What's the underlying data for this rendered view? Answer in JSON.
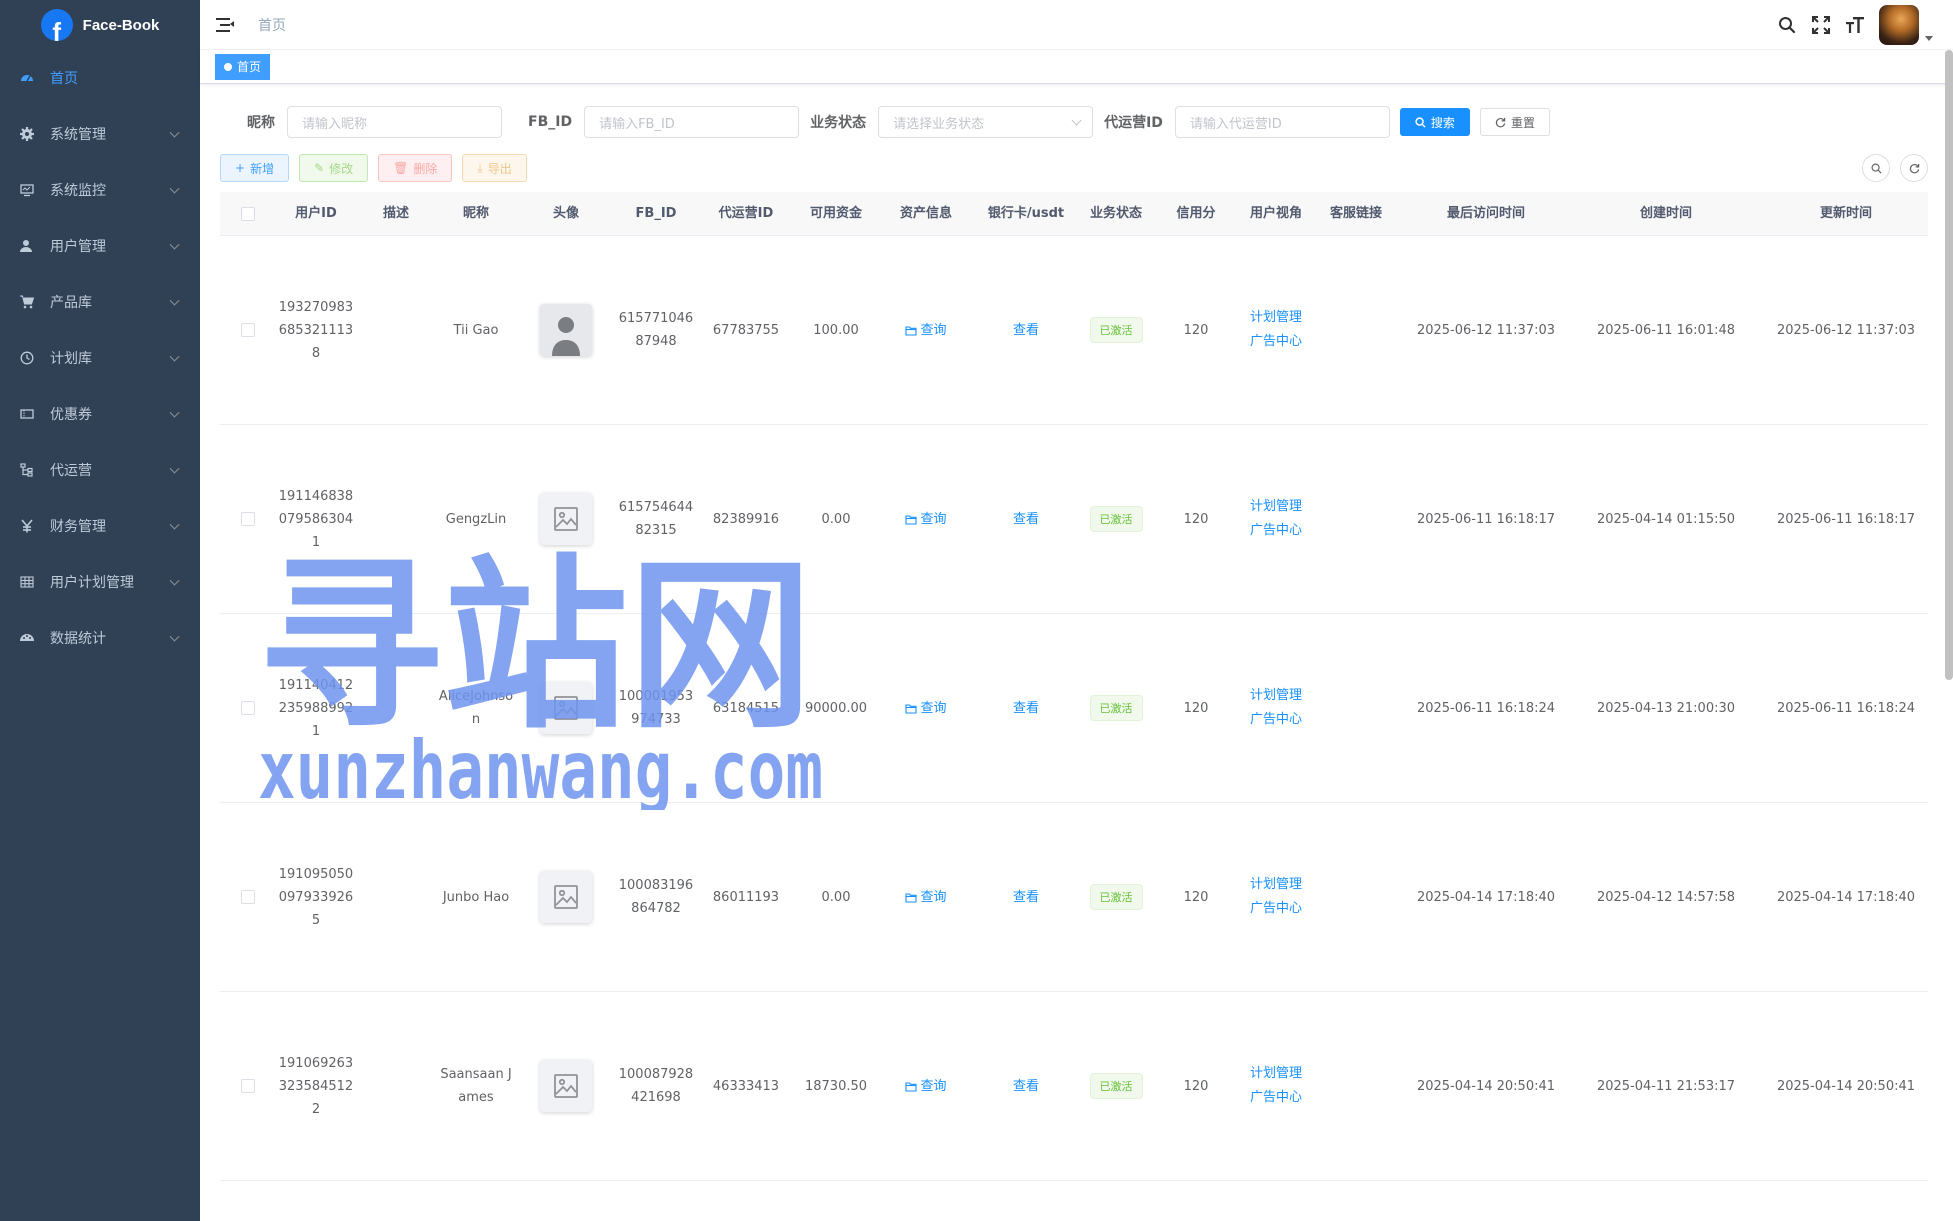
{
  "app": {
    "title": "Face-Book",
    "logo_letter": "f"
  },
  "sidebar": {
    "items": [
      {
        "label": "首页",
        "icon": "dashboard-icon",
        "active": true,
        "expandable": false
      },
      {
        "label": "系统管理",
        "icon": "gear-icon",
        "expandable": true
      },
      {
        "label": "系统监控",
        "icon": "monitor-icon",
        "expandable": true
      },
      {
        "label": "用户管理",
        "icon": "user-icon",
        "expandable": true
      },
      {
        "label": "产品库",
        "icon": "cart-icon",
        "expandable": true
      },
      {
        "label": "计划库",
        "icon": "clock-icon",
        "expandable": true
      },
      {
        "label": "优惠券",
        "icon": "coupon-icon",
        "expandable": true
      },
      {
        "label": "代运营",
        "icon": "tree-icon",
        "expandable": true
      },
      {
        "label": "财务管理",
        "icon": "yen-icon",
        "expandable": true
      },
      {
        "label": "用户计划管理",
        "icon": "table-icon",
        "expandable": true
      },
      {
        "label": "数据统计",
        "icon": "chart-icon",
        "expandable": true
      }
    ]
  },
  "navbar": {
    "breadcrumb": "首页"
  },
  "tags": {
    "active": "首页"
  },
  "search": {
    "nickname_label": "昵称",
    "nickname_placeholder": "请输入昵称",
    "fbid_label": "FB_ID",
    "fbid_placeholder": "请输入FB_ID",
    "status_label": "业务状态",
    "status_placeholder": "请选择业务状态",
    "agent_label": "代运营ID",
    "agent_placeholder": "请输入代运营ID",
    "search_btn": "搜索",
    "reset_btn": "重置"
  },
  "toolbar": {
    "add": "新增",
    "edit": "修改",
    "delete": "删除",
    "export": "导出"
  },
  "table": {
    "headers": [
      "用户ID",
      "描述",
      "昵称",
      "头像",
      "FB_ID",
      "代运营ID",
      "可用资金",
      "资产信息",
      "银行卡/usdt",
      "业务状态",
      "信用分",
      "用户视角",
      "客服链接",
      "最后访问时间",
      "创建时间",
      "更新时间"
    ],
    "rows": [
      {
        "id": "1932709836853211138",
        "desc": "",
        "nick": "Tii Gao",
        "avatar": "person",
        "fbid": "61577104687948",
        "agent": "67783755",
        "fund": "100.00",
        "asset": "查询",
        "bank": "查看",
        "status": "已激活",
        "credit": "120",
        "view1": "计划管理",
        "view2": "广告中心",
        "service": "",
        "last": "2025-06-12 11:37:03",
        "created": "2025-06-11 16:01:48",
        "updated": "2025-06-12 11:37:03"
      },
      {
        "id": "1911468380795863041",
        "desc": "",
        "nick": "GengzLin",
        "avatar": "image",
        "fbid": "61575464482315",
        "agent": "82389916",
        "fund": "0.00",
        "asset": "查询",
        "bank": "查看",
        "status": "已激活",
        "credit": "120",
        "view1": "计划管理",
        "view2": "广告中心",
        "service": "",
        "last": "2025-06-11 16:18:17",
        "created": "2025-04-14 01:15:50",
        "updated": "2025-06-11 16:18:17"
      },
      {
        "id": "1911404122359889921",
        "desc": "",
        "nick": "AliceJohnson",
        "avatar": "image",
        "fbid": "100001953974733",
        "agent": "63184515",
        "fund": "90000.00",
        "asset": "查询",
        "bank": "查看",
        "status": "已激活",
        "credit": "120",
        "view1": "计划管理",
        "view2": "广告中心",
        "service": "",
        "last": "2025-06-11 16:18:24",
        "created": "2025-04-13 21:00:30",
        "updated": "2025-06-11 16:18:24"
      },
      {
        "id": "1910950500979339265",
        "desc": "",
        "nick": "Junbo Hao",
        "avatar": "image",
        "fbid": "100083196864782",
        "agent": "86011193",
        "fund": "0.00",
        "asset": "查询",
        "bank": "查看",
        "status": "已激活",
        "credit": "120",
        "view1": "计划管理",
        "view2": "广告中心",
        "service": "",
        "last": "2025-04-14 17:18:40",
        "created": "2025-04-12 14:57:58",
        "updated": "2025-04-14 17:18:40"
      },
      {
        "id": "1910692633235845122",
        "desc": "",
        "nick": "Saansaan James",
        "avatar": "image",
        "fbid": "100087928421698",
        "agent": "46333413",
        "fund": "18730.50",
        "asset": "查询",
        "bank": "查看",
        "status": "已激活",
        "credit": "120",
        "view1": "计划管理",
        "view2": "广告中心",
        "service": "",
        "last": "2025-04-14 20:50:41",
        "created": "2025-04-11 21:53:17",
        "updated": "2025-04-14 20:50:41"
      }
    ]
  },
  "watermark": {
    "line1": "寻站网",
    "line2": "xunzhanwang.com"
  },
  "colors": {
    "sidebar_bg": "#304156",
    "primary": "#1890ff",
    "success": "#67c23a"
  }
}
